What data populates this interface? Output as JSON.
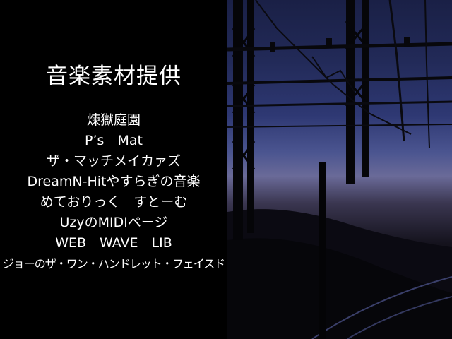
{
  "credits": {
    "title": "音楽素材提供",
    "items": [
      "煉獄庭園",
      "P’s　Mat",
      "ザ・マッチメイカァズ",
      "DreamN-Hitやすらぎの音楽",
      "めておりっく　すとーむ",
      "UzyのMIDIページ",
      "WEB　WAVE　LIB",
      "ジョーのザ・ワン・ハンドレット・フェイスド"
    ]
  },
  "colors": {
    "background": "#000000",
    "text": "#ffffff",
    "sky_top": "#1a2046",
    "sky_horizon": "#6a6a98"
  }
}
